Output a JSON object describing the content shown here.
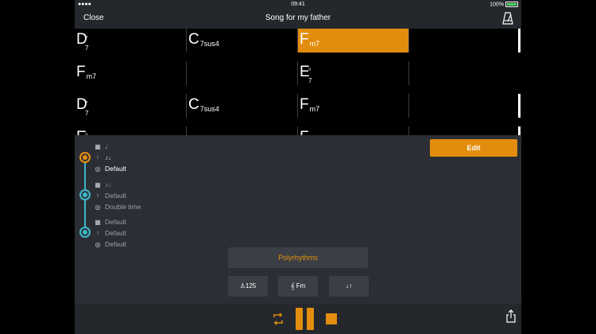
{
  "status_bar": {
    "signal": "●●●●",
    "time": "09:41",
    "battery": "100%"
  },
  "nav": {
    "close_label": "Close",
    "title": "Song for my father",
    "metronome_icon": "metronome-icon"
  },
  "grid": {
    "rows": [
      [
        {
          "root": "D",
          "accidental": "♭",
          "quality": "7"
        },
        {
          "root": "C",
          "quality": "7sus4"
        },
        {
          "root": "F",
          "quality": "m7",
          "highlighted": true
        },
        {
          "root": ""
        }
      ],
      [
        {
          "root": "F",
          "quality": "m7"
        },
        {
          "root": ""
        },
        {
          "root": "E",
          "accidental": "♭",
          "quality": "7"
        },
        {
          "root": ""
        }
      ],
      [
        {
          "root": "D",
          "accidental": "♭",
          "quality": "7"
        },
        {
          "root": "C",
          "quality": "7sus4"
        },
        {
          "root": "F",
          "quality": "m7"
        },
        {
          "root": ""
        }
      ],
      [
        {
          "root": "E",
          "accidental": "♭"
        },
        {
          "root": ""
        },
        {
          "root": "F"
        },
        {
          "root": ""
        }
      ]
    ],
    "highlight_color": "#e38d0e"
  },
  "panel": {
    "edit_label": "Edit",
    "timeline": [
      {
        "node_color": "orange",
        "lines": [
          {
            "icon": "piano-icon",
            "text": "♩"
          },
          {
            "icon": "thermometer-icon",
            "text": "♪♩"
          },
          {
            "icon": "drum-icon",
            "text": "Default",
            "bright": true
          }
        ]
      },
      {
        "node_color": "teal",
        "lines": [
          {
            "icon": "piano-icon",
            "text": "♪♩"
          },
          {
            "icon": "thermometer-icon",
            "text": "Default"
          },
          {
            "icon": "drum-icon",
            "text": "Double time"
          }
        ]
      },
      {
        "node_color": "teal",
        "lines": [
          {
            "icon": "piano-icon",
            "text": "Default"
          },
          {
            "icon": "thermometer-icon",
            "text": "Default"
          },
          {
            "icon": "drum-icon",
            "text": "Default"
          }
        ]
      }
    ],
    "polyrhythms_label": "Polyrhythms",
    "tempo_label": "125",
    "key_label": "Fm",
    "mixer_label": "↓↑"
  },
  "colors": {
    "accent": "#e38d0e",
    "teal": "#3fb6c9",
    "panel": "#2b2f35",
    "grid_bg": "#000000"
  }
}
